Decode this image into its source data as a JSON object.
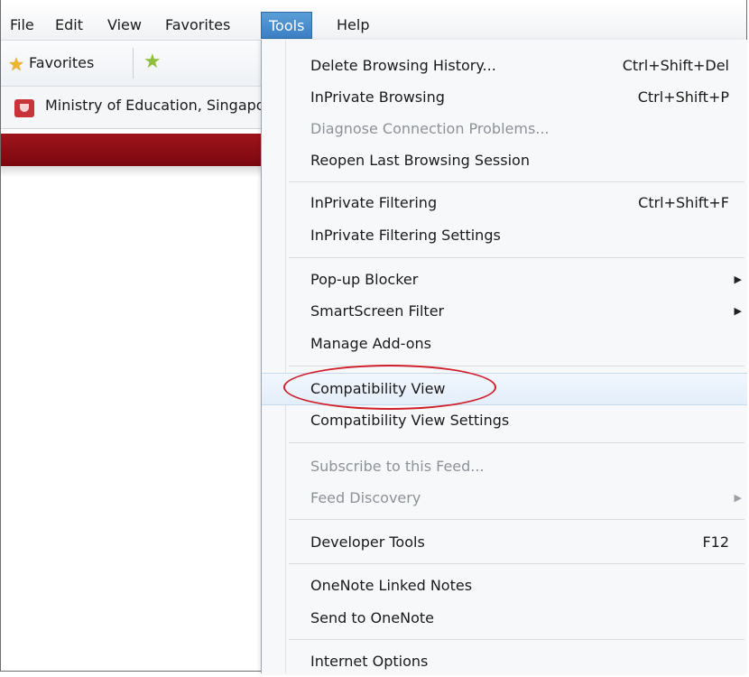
{
  "menubar": {
    "items": [
      {
        "label": "File"
      },
      {
        "label": "Edit"
      },
      {
        "label": "View"
      },
      {
        "label": "Favorites"
      },
      {
        "label": "Tools",
        "active": true
      },
      {
        "label": "Help"
      }
    ]
  },
  "favorites_bar": {
    "favorites_label": "Favorites"
  },
  "tab": {
    "title": "Ministry of Education, Singapore"
  },
  "tools_menu": {
    "groups": [
      [
        {
          "label": "Delete Browsing History...",
          "shortcut": "Ctrl+Shift+Del"
        },
        {
          "label": "InPrivate Browsing",
          "shortcut": "Ctrl+Shift+P"
        },
        {
          "label": "Diagnose Connection Problems...",
          "disabled": true
        },
        {
          "label": "Reopen Last Browsing Session"
        }
      ],
      [
        {
          "label": "InPrivate Filtering",
          "shortcut": "Ctrl+Shift+F"
        },
        {
          "label": "InPrivate Filtering Settings"
        }
      ],
      [
        {
          "label": "Pop-up Blocker",
          "submenu": true
        },
        {
          "label": "SmartScreen Filter",
          "submenu": true
        },
        {
          "label": "Manage Add-ons"
        }
      ],
      [
        {
          "label": "Compatibility View",
          "highlighted": true
        },
        {
          "label": "Compatibility View Settings"
        }
      ],
      [
        {
          "label": "Subscribe to this Feed...",
          "disabled": true
        },
        {
          "label": "Feed Discovery",
          "disabled": true,
          "submenu": true
        }
      ],
      [
        {
          "label": "Developer Tools",
          "shortcut": "F12"
        }
      ],
      [
        {
          "label": "OneNote Linked Notes"
        },
        {
          "label": "Send to OneNote"
        }
      ],
      [
        {
          "label": "Internet Options"
        }
      ]
    ]
  },
  "colors": {
    "active_menu": "#3b7ec4",
    "banner": "#8c0e16",
    "annotation_circle": "#cf1f2a",
    "disabled_text": "#8d9298"
  }
}
